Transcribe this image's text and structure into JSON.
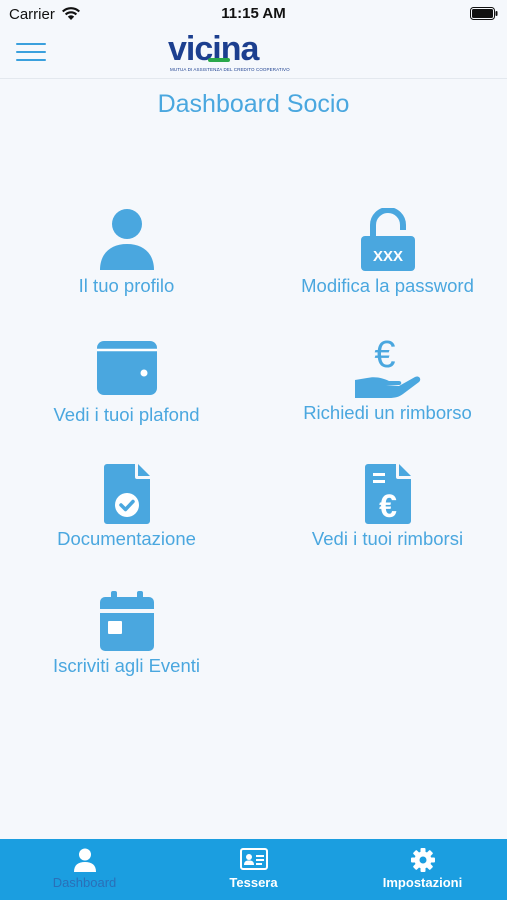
{
  "status_bar": {
    "carrier": "Carrier",
    "time": "11:15 AM"
  },
  "header": {
    "logo_text": "vicina",
    "logo_subtitle": "MUTUA DI ASSISTENZA DEL CREDITO COOPERATIVO"
  },
  "page": {
    "title": "Dashboard Socio"
  },
  "menu": [
    {
      "label": "Il tuo profilo",
      "icon": "user-icon"
    },
    {
      "label": "Modifica la password",
      "icon": "lock-open-icon",
      "icon_text": "XXX"
    },
    {
      "label": "Vedi i tuoi plafond",
      "icon": "wallet-icon"
    },
    {
      "label": "Richiedi un rimborso",
      "icon": "euro-hand-icon",
      "icon_text": "€"
    },
    {
      "label": "Documentazione",
      "icon": "document-check-icon"
    },
    {
      "label": "Vedi i tuoi rimborsi",
      "icon": "document-euro-icon",
      "icon_text": "€"
    },
    {
      "label": "Iscriviti agli Eventi",
      "icon": "calendar-icon"
    }
  ],
  "tabbar": {
    "tabs": [
      {
        "label": "Dashboard",
        "icon": "person-icon",
        "active": true
      },
      {
        "label": "Tessera",
        "icon": "id-card-icon",
        "active": false
      },
      {
        "label": "Impostazioni",
        "icon": "gear-icon",
        "active": false
      }
    ]
  },
  "colors": {
    "accent": "#4aa7df",
    "tabbar": "#1b9ee0",
    "background": "#f5f8fc",
    "logo_blue": "#1c3f8f",
    "logo_green": "#2aa84a"
  }
}
